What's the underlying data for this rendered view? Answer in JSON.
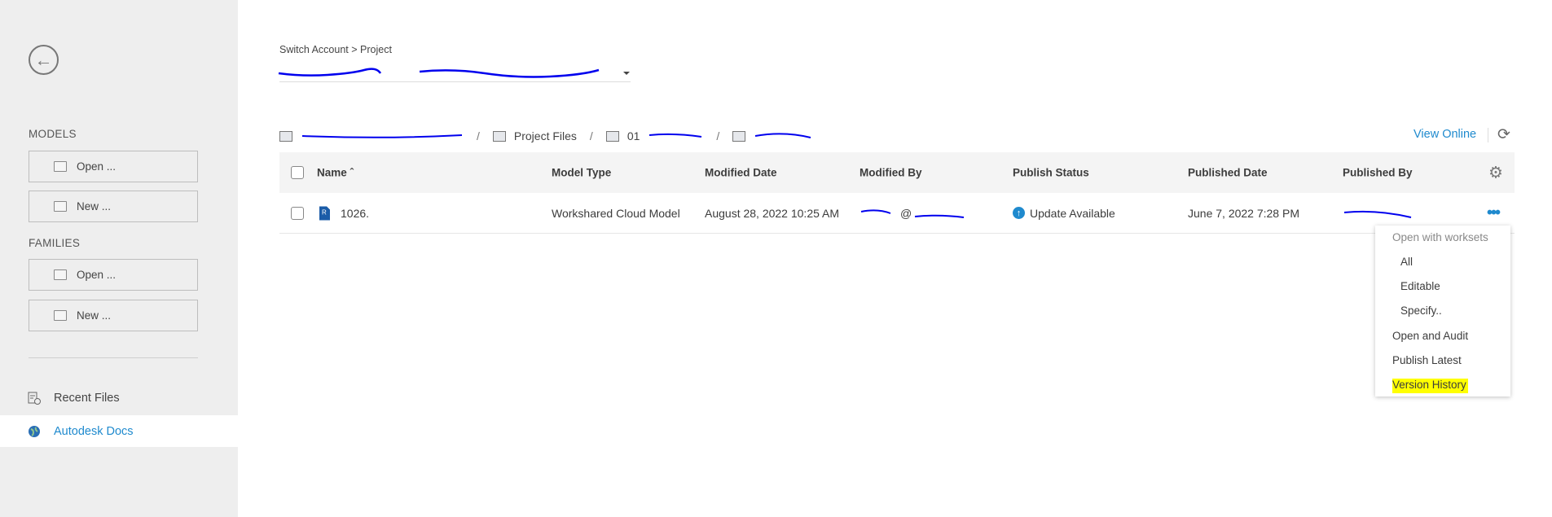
{
  "sidebar": {
    "models_label": "MODELS",
    "families_label": "FAMILIES",
    "models_open": "Open ...",
    "models_new": "New ...",
    "families_open": "Open ...",
    "families_new": "New ...",
    "recent_files": "Recent Files",
    "autodesk_docs": "Autodesk Docs"
  },
  "breadcrumb": "Switch Account > Project",
  "path": {
    "project_files": "Project Files",
    "folder_01": "01"
  },
  "toolbar": {
    "view_online": "View Online"
  },
  "table": {
    "headers": {
      "name": "Name",
      "model_type": "Model Type",
      "modified_date": "Modified Date",
      "modified_by": "Modified By",
      "publish_status": "Publish Status",
      "published_date": "Published Date",
      "published_by": "Published By"
    },
    "rows": [
      {
        "name": "1026.",
        "model_type": "Workshared Cloud Model",
        "modified_date": "August 28, 2022 10:25 AM",
        "modified_by_at": "@",
        "publish_status": "Update Available",
        "published_date": "June 7, 2022 7:28 PM"
      }
    ]
  },
  "context_menu": {
    "header": "Open with worksets",
    "items": [
      "All",
      "Editable",
      "Specify..",
      "Open and Audit",
      "Publish Latest",
      "Version History"
    ]
  },
  "colors": {
    "accent": "#1f8ace",
    "highlight": "#ffff00",
    "redaction": "#0000ee"
  }
}
